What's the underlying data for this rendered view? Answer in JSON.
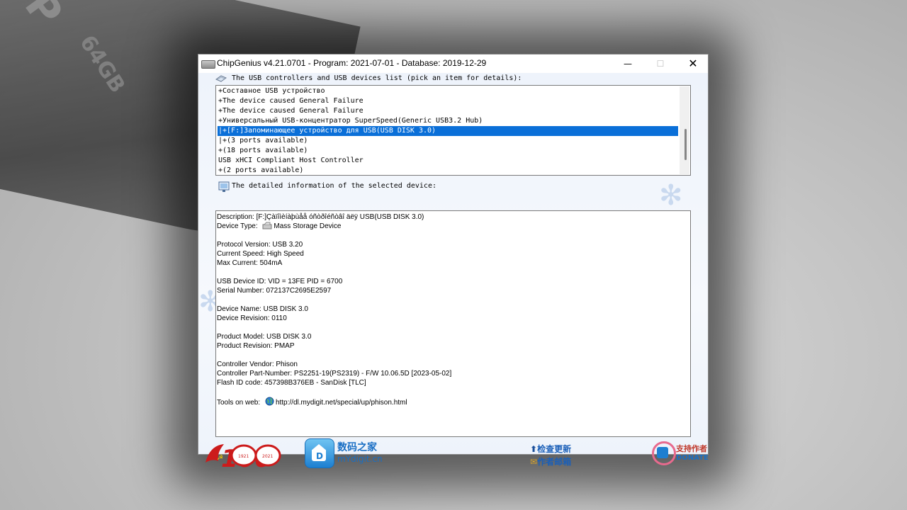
{
  "background": {
    "brand_text": "SP",
    "model_text": "64GB"
  },
  "window": {
    "title": "ChipGenius v4.21.0701 - Program: 2021-07-01 - Database: 2019-12-29",
    "controls": {
      "minimize": "—",
      "maximize": "☐",
      "close": "✕"
    }
  },
  "devices": {
    "label": "The USB controllers and USB devices list (pick an item for details):",
    "items": [
      {
        "text": "+Составное USB устройство",
        "selected": false
      },
      {
        "text": "+The device caused General Failure",
        "selected": false
      },
      {
        "text": "+The device caused General Failure",
        "selected": false
      },
      {
        "text": "+Универсальный USB-концентратор SuperSpeed(Generic USB3.2 Hub)",
        "selected": false
      },
      {
        "text": "|+[F:]Запоминающее устройство для USB(USB DISK 3.0)",
        "selected": true
      },
      {
        "text": "|+(3 ports available)",
        "selected": false
      },
      {
        "text": "+(18 ports available)",
        "selected": false
      },
      {
        "text": "USB xHCI Compliant Host Controller",
        "selected": false
      },
      {
        "text": "+(2 ports available)",
        "selected": false
      }
    ]
  },
  "details": {
    "label": "The detailed information of the selected device:",
    "description": "Description: [F:]Çàïîìèíàþùåå óñòðîéñòâî äëÿ USB(USB DISK 3.0)",
    "device_type_label": "Device Type:",
    "device_type_value": "Mass Storage Device",
    "protocol_version": "Protocol Version: USB 3.20",
    "current_speed": "Current Speed: High Speed",
    "max_current": "Max Current: 504mA",
    "usb_device_id": "USB Device ID: VID = 13FE PID = 6700",
    "serial_number": "Serial Number: 072137C2695E2597",
    "device_name": "Device Name: USB DISK 3.0",
    "device_revision": "Device Revision: 0110",
    "product_model": "Product Model: USB DISK 3.0",
    "product_revision": "Product Revision: PMAP",
    "controller_vendor": "Controller Vendor: Phison",
    "controller_part_number": "Controller Part-Number: PS2251-19(PS2319) - F/W 10.06.5D [2023-05-02]",
    "flash_id": "Flash ID code: 457398B376EB - SanDisk [TLC]",
    "tools_label": "Tools on web:",
    "tools_url": "http://dl.mydigit.net/special/up/phison.html"
  },
  "footer": {
    "badge_years_left": "1921",
    "badge_years_right": "2021",
    "badge_number": "100",
    "site_cn": "数码之家",
    "site_en": "mYdigit.cn",
    "check_update": "检查更新",
    "author_email": "作者邮箱",
    "donate_cn": "支持作者",
    "donate_en": "DONATE",
    "logo_letter": "D"
  },
  "colors": {
    "selection": "#0a6fd8",
    "link_blue": "#1a5fb8",
    "badge_red": "#cc1b1b"
  }
}
